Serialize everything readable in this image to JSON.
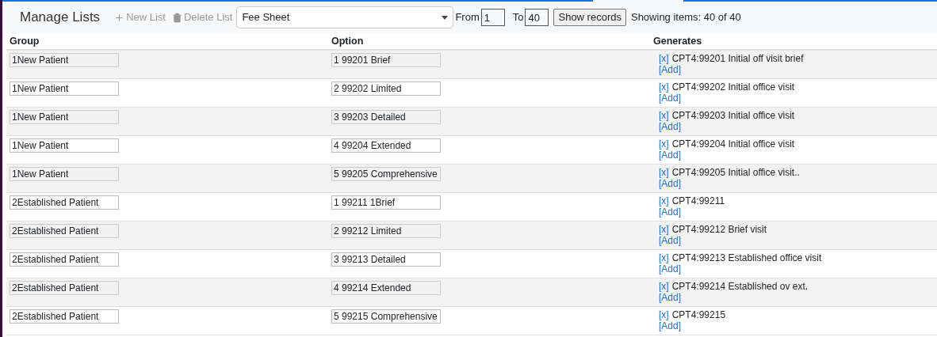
{
  "header": {
    "title": "Manage Lists",
    "new_list": "New List",
    "delete_list": "Delete List",
    "list_select": "Fee Sheet",
    "from_label": "From",
    "from_value": "1",
    "to_label": "To",
    "to_value": "40",
    "show_button": "Show records",
    "showing": "Showing items: 40 of 40"
  },
  "table": {
    "columns": [
      "Group",
      "Option",
      "Generates"
    ],
    "rows": [
      {
        "group": "1New Patient",
        "option": "1 99201 Brief",
        "remove": "[x]",
        "code": "CPT4:99201 Initial off visit brief",
        "add": "[Add]"
      },
      {
        "group": "1New Patient",
        "option": "2 99202 Limited",
        "remove": "[x]",
        "code": "CPT4:99202 Initial office visit",
        "add": "[Add]"
      },
      {
        "group": "1New Patient",
        "option": "3 99203 Detailed",
        "remove": "[x]",
        "code": "CPT4:99203 Initial office visit",
        "add": "[Add]"
      },
      {
        "group": "1New Patient",
        "option": "4 99204 Extended",
        "remove": "[x]",
        "code": "CPT4:99204 Initial office visit",
        "add": "[Add]"
      },
      {
        "group": "1New Patient",
        "option": "5 99205 Comprehensive",
        "remove": "[x]",
        "code": "CPT4:99205 Initial office visit..",
        "add": "[Add]"
      },
      {
        "group": "2Established Patient",
        "option": "1 99211 1Brief",
        "remove": "[x]",
        "code": "CPT4:99211",
        "add": "[Add]"
      },
      {
        "group": "2Established Patient",
        "option": "2 99212 Limited",
        "remove": "[x]",
        "code": "CPT4:99212 Brief visit",
        "add": "[Add]"
      },
      {
        "group": "2Established Patient",
        "option": "3 99213 Detailed",
        "remove": "[x]",
        "code": "CPT4:99213 Established office visit",
        "add": "[Add]"
      },
      {
        "group": "2Established Patient",
        "option": "4 99214 Extended",
        "remove": "[x]",
        "code": "CPT4:99214 Established ov ext.",
        "add": "[Add]"
      },
      {
        "group": "2Established Patient",
        "option": "5 99215 Comprehensive",
        "remove": "[x]",
        "code": "CPT4:99215",
        "add": "[Add]"
      }
    ]
  }
}
